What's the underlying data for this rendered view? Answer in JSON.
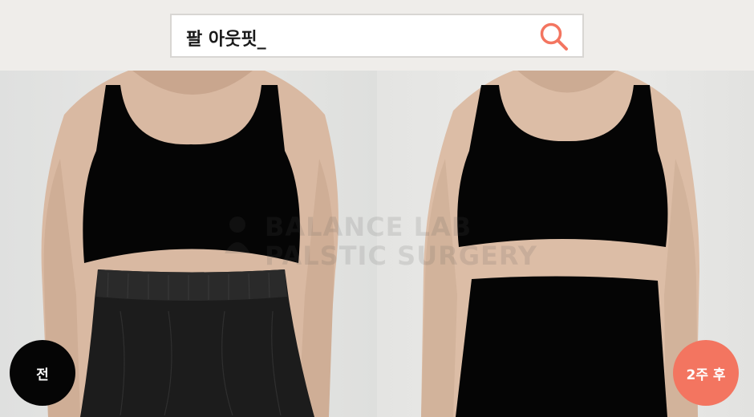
{
  "search": {
    "query": "팔 아웃핏_",
    "icon": "search-icon"
  },
  "watermark": {
    "line1": "BALANCE LAB",
    "line2": "PALSTIC SURGERY"
  },
  "badges": {
    "before": "전",
    "after": "2주 후"
  },
  "colors": {
    "accent": "#f37560",
    "before_badge": "#050505",
    "topbar_bg": "#efedea"
  }
}
